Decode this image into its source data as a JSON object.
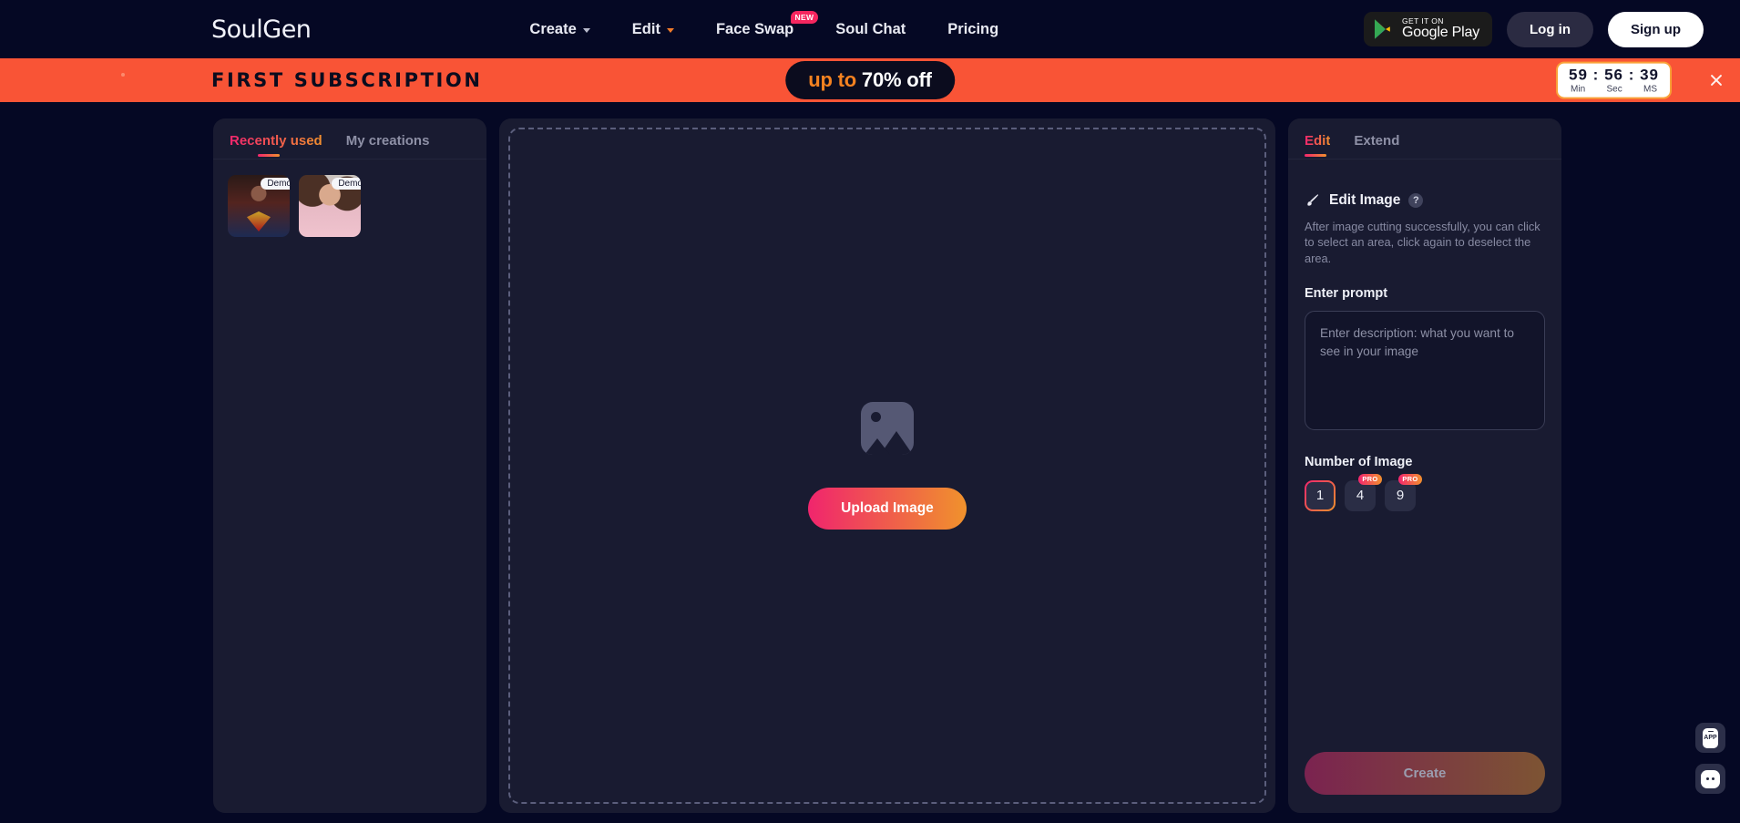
{
  "brand": {
    "logo": "SoulGen"
  },
  "nav": {
    "links": [
      {
        "label": "Create",
        "has_caret": true,
        "active": false,
        "badge": null
      },
      {
        "label": "Edit",
        "has_caret": true,
        "active": true,
        "badge": null
      },
      {
        "label": "Face Swap",
        "has_caret": false,
        "active": false,
        "badge": "NEW"
      },
      {
        "label": "Soul Chat",
        "has_caret": false,
        "active": false,
        "badge": null
      },
      {
        "label": "Pricing",
        "has_caret": false,
        "active": false,
        "badge": null
      }
    ],
    "google_play": {
      "small": "GET IT ON",
      "big": "Google Play"
    },
    "login_label": "Log in",
    "signup_label": "Sign up"
  },
  "promo": {
    "title": "FIRST SUBSCRIPTION",
    "pill_prefix": "up to ",
    "pill_highlight": "70% off",
    "timer": {
      "value": "59 : 56 : 39",
      "min_label": "Min",
      "sec_label": "Sec",
      "ms_label": "MS"
    },
    "close_icon": "close-icon"
  },
  "left_panel": {
    "tabs": [
      {
        "label": "Recently used",
        "active": true
      },
      {
        "label": "My creations",
        "active": false
      }
    ],
    "thumbnails": [
      {
        "tag": "Demo",
        "alt": "superman-demo"
      },
      {
        "tag": "Demo",
        "alt": "woman-pink-demo"
      }
    ]
  },
  "canvas": {
    "placeholder_icon": "image-placeholder-icon",
    "upload_label": "Upload Image"
  },
  "right_panel": {
    "tabs": [
      {
        "label": "Edit",
        "active": true
      },
      {
        "label": "Extend",
        "active": false
      }
    ],
    "section_icon": "magic-brush-icon",
    "section_title": "Edit Image",
    "help_icon": "?",
    "description": "After image cutting successfully, you can click to select an area, click again to deselect the area.",
    "prompt_label": "Enter prompt",
    "prompt_value": "",
    "prompt_placeholder": "Enter description: what you want to see in your image",
    "number_label": "Number of Image",
    "number_options": [
      {
        "value": "1",
        "selected": true,
        "badge": null
      },
      {
        "value": "4",
        "selected": false,
        "badge": "PRO"
      },
      {
        "value": "9",
        "selected": false,
        "badge": "PRO"
      }
    ],
    "create_label": "Create"
  },
  "floaters": [
    {
      "name": "app-download-button",
      "label": "APP"
    },
    {
      "name": "chat-support-button",
      "label": ""
    }
  ],
  "colors": {
    "page_bg": "#050824",
    "panel_bg": "#191B31",
    "accent_pink": "#F0256D",
    "accent_orange": "#F0922C",
    "promo_bg": "#F95436",
    "badge_red": "#F5265F"
  }
}
